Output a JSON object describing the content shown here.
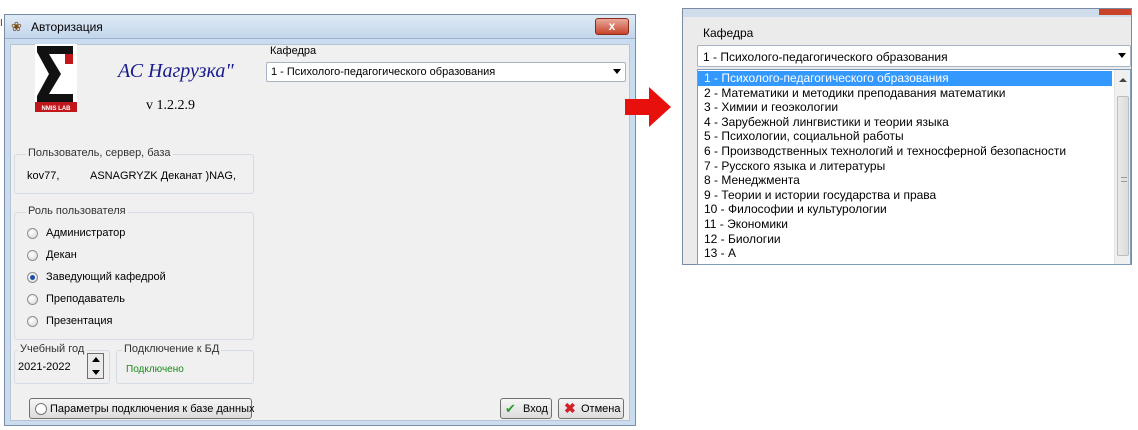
{
  "dialog": {
    "title": "Авторизация",
    "close_label": "x",
    "app_name": "АС Нагрузка\"",
    "version": "v 1.2.2.9",
    "logo_text": "NMIS LAB",
    "user_group": {
      "caption": "Пользователь, сервер, база",
      "user": "kov77,",
      "server_db": "ASNAGRYZK Деканат )NAG,"
    },
    "role_group": {
      "caption": "Роль пользователя",
      "options": [
        {
          "label": "Администратор",
          "selected": false
        },
        {
          "label": "Декан",
          "selected": false
        },
        {
          "label": "Заведующий кафедрой",
          "selected": true
        },
        {
          "label": "Преподаватель",
          "selected": false
        },
        {
          "label": "Презентация",
          "selected": false
        }
      ]
    },
    "year_group": {
      "caption": "Учебный год",
      "value": "2021-2022"
    },
    "db_group": {
      "caption": "Подключение к БД",
      "status": "Подключено",
      "status_color": "#1a8a1a"
    },
    "db_params_button": "Параметры подключения к базе данных",
    "department": {
      "caption": "Кафедра",
      "selected": "1 - Психолого-педагогического образования"
    },
    "login_button": "Вход",
    "cancel_button": "Отмена"
  },
  "dropdown_panel": {
    "caption": "Кафедра",
    "selected": "1 - Психолого-педагогического образования",
    "items": [
      "1 - Психолого-педагогического образования",
      "2 - Математики и методики преподавания математики",
      "3 - Химии и геоэкологии",
      "4 - Зарубежной лингвистики и теории языка",
      "5 - Психологии, социальной работы",
      "6 - Производственных технологий и техносферной безопасности",
      "7 - Русского языка и литературы",
      "8 - Менеджмента",
      "9 - Теории и истории государства и права",
      "10 - Философии и культурологии",
      "11 - Экономики",
      "12 - Биологии",
      "13 - А"
    ]
  },
  "colors": {
    "accent_arrow": "#e8100c",
    "selection": "#3399ff",
    "title_blue": "#1a1a8c"
  }
}
